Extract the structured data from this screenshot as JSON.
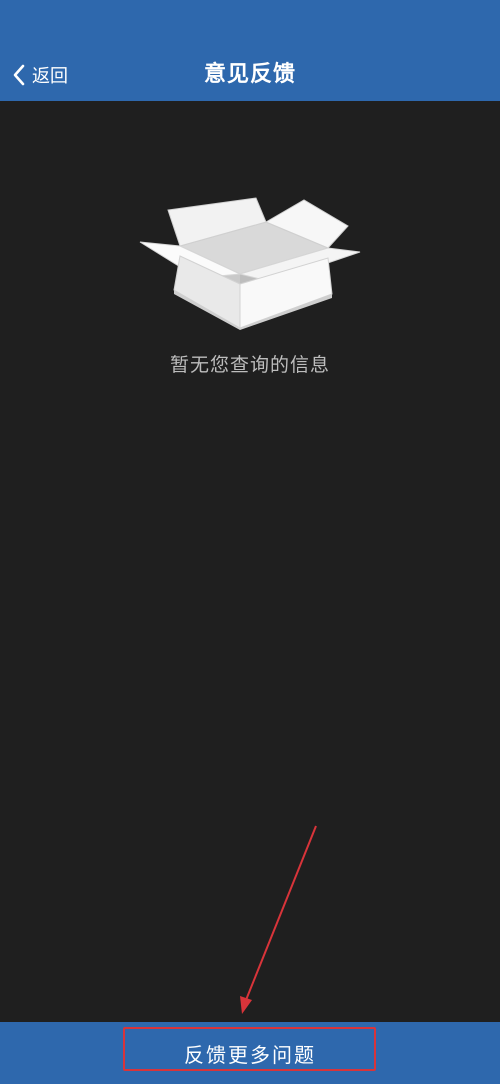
{
  "header": {
    "back_label": "返回",
    "title": "意见反馈",
    "background_color": "#2e68ad"
  },
  "empty_state": {
    "icon": "open-box-icon",
    "message": "暂无您查询的信息"
  },
  "footer": {
    "button_label": "反馈更多问题"
  },
  "annotation": {
    "color": "#d8343a"
  }
}
